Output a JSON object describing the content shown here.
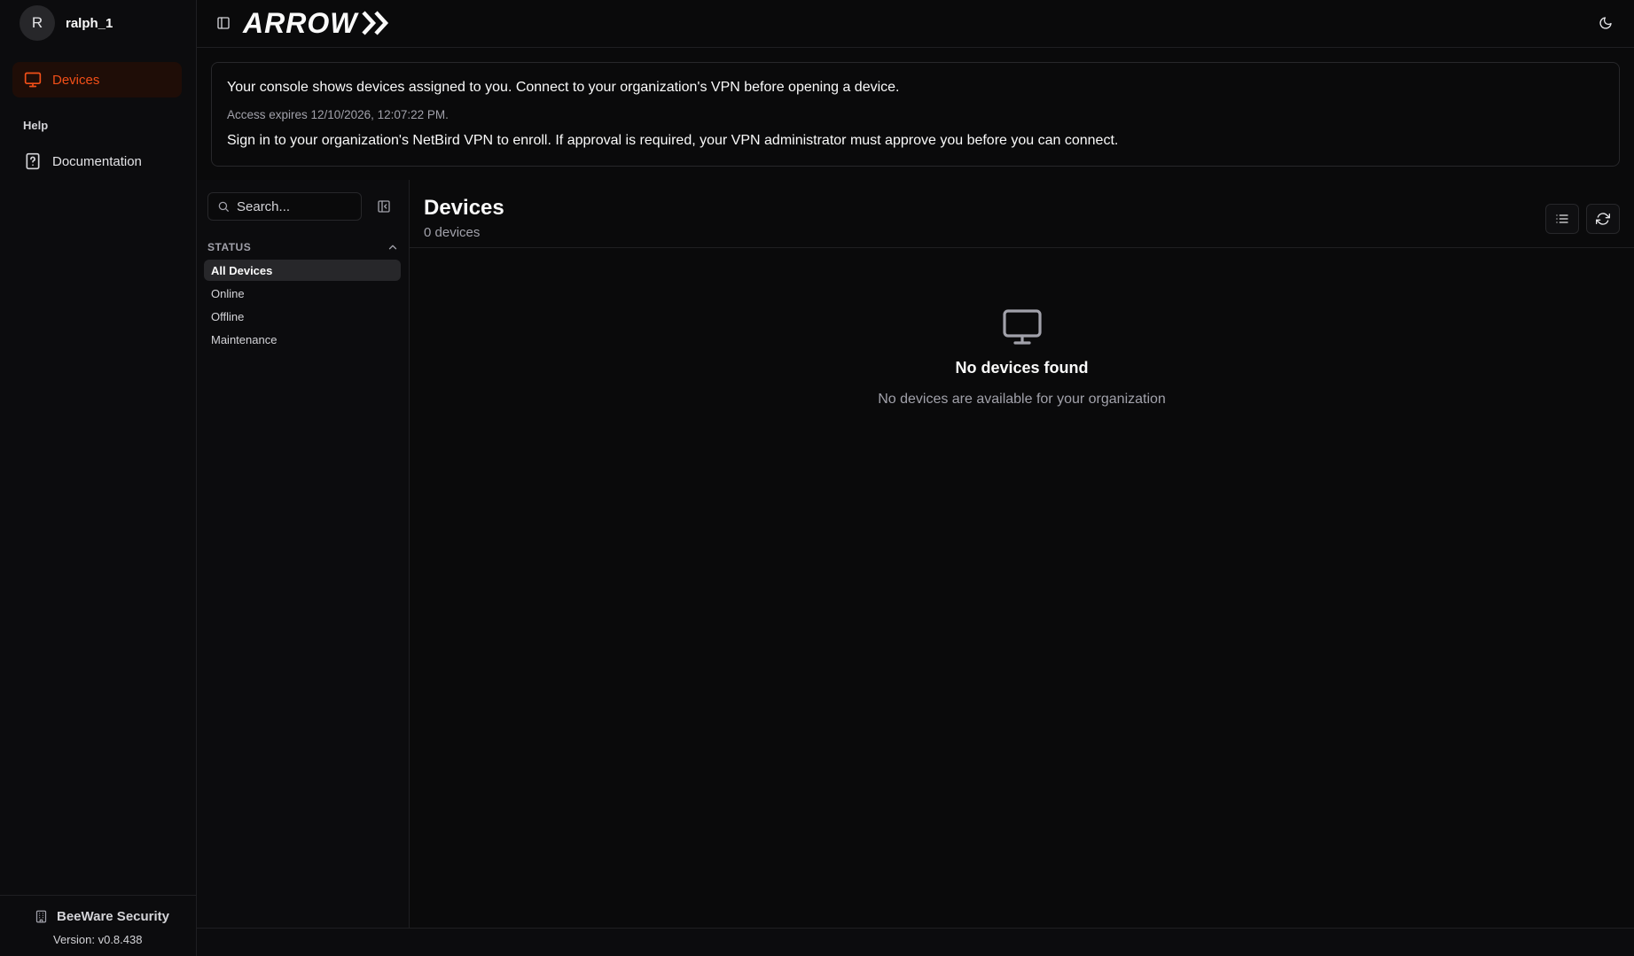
{
  "user": {
    "initial": "R",
    "name": "ralph_1"
  },
  "sidebar": {
    "items": [
      {
        "label": "Devices",
        "icon": "monitor-icon",
        "active": true
      }
    ],
    "section_help": "Help",
    "help_items": [
      {
        "label": "Documentation",
        "icon": "help-file-icon"
      }
    ],
    "org": {
      "name": "BeeWare Security",
      "icon": "building-icon"
    },
    "version": "Version: v0.8.438"
  },
  "topbar": {
    "logo_text": "ARROW"
  },
  "banner": {
    "line1": "Your console shows devices assigned to you. Connect to your organization's VPN before opening a device.",
    "line2": "Access expires 12/10/2026, 12:07:22 PM.",
    "line3": "Sign in to your organization's NetBird VPN to enroll. If approval is required, your VPN administrator must approve you before you can connect."
  },
  "filters": {
    "search_placeholder": "Search...",
    "status_title": "STATUS",
    "items": [
      "All Devices",
      "Online",
      "Offline",
      "Maintenance"
    ],
    "active": "All Devices"
  },
  "main": {
    "title": "Devices",
    "count": "0 devices",
    "empty_title": "No devices found",
    "empty_subtitle": "No devices are available for your organization"
  },
  "colors": {
    "accent": "#f24f18",
    "background": "#0a0a0b",
    "surface": "#0c0c0e",
    "border": "#27272a"
  }
}
